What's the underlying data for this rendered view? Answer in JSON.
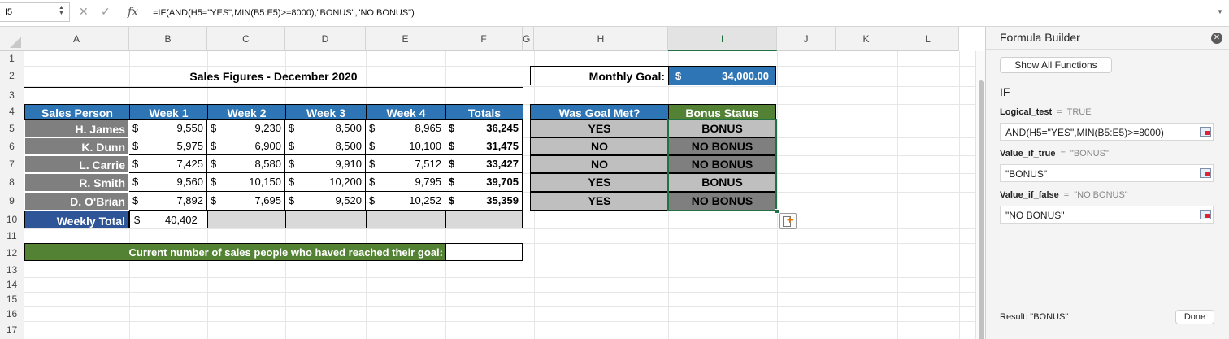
{
  "formula_bar": {
    "name_box": "I5",
    "cancel_glyph": "✕",
    "enter_glyph": "✓",
    "fx_label": "fx",
    "formula": "=IF(AND(H5=\"YES\",MIN(B5:E5)>=8000),\"BONUS\",\"NO BONUS\")"
  },
  "columns": [
    "A",
    "B",
    "C",
    "D",
    "E",
    "F",
    "G",
    "H",
    "I",
    "J",
    "K",
    "L"
  ],
  "selected_column": "I",
  "rows": [
    "1",
    "2",
    "3",
    "4",
    "5",
    "6",
    "7",
    "8",
    "9",
    "10",
    "11",
    "12",
    "13",
    "14",
    "15",
    "16",
    "17"
  ],
  "sheet": {
    "title": "Sales Figures - December 2020",
    "monthly_goal_label": "Monthly Goal:",
    "monthly_goal_currency": "$",
    "monthly_goal_value": "34,000.00",
    "headers": [
      "Sales Person",
      "Week 1",
      "Week 2",
      "Week 3",
      "Week 4",
      "Totals"
    ],
    "goal_header": "Was Goal Met?",
    "bonus_header": "Bonus Status",
    "currency": "$",
    "data": [
      {
        "name": "H. James",
        "w1": "9,550",
        "w2": "9,230",
        "w3": "8,500",
        "w4": "8,965",
        "total": "36,245",
        "goal": "YES",
        "bonus": "BONUS"
      },
      {
        "name": "K. Dunn",
        "w1": "5,975",
        "w2": "6,900",
        "w3": "8,500",
        "w4": "10,100",
        "total": "31,475",
        "goal": "NO",
        "bonus": "NO BONUS"
      },
      {
        "name": "L. Carrie",
        "w1": "7,425",
        "w2": "8,580",
        "w3": "9,910",
        "w4": "7,512",
        "total": "33,427",
        "goal": "NO",
        "bonus": "NO BONUS"
      },
      {
        "name": "R. Smith",
        "w1": "9,560",
        "w2": "10,150",
        "w3": "10,200",
        "w4": "9,795",
        "total": "39,705",
        "goal": "YES",
        "bonus": "BONUS"
      },
      {
        "name": "D. O'Brian",
        "w1": "7,892",
        "w2": "7,695",
        "w3": "9,520",
        "w4": "10,252",
        "total": "35,359",
        "goal": "YES",
        "bonus": "NO BONUS"
      }
    ],
    "weekly_total_label": "Weekly Total",
    "weekly_total_value": "40,402",
    "reached_goal_label": "Current number of sales people who haved reached their goal:"
  },
  "formula_builder": {
    "title": "Formula Builder",
    "close_glyph": "✕",
    "show_all_label": "Show All Functions",
    "function_name": "IF",
    "args": [
      {
        "label": "Logical_test",
        "eq": "=",
        "value": "TRUE",
        "input": "AND(H5=\"YES\",MIN(B5:E5)>=8000)"
      },
      {
        "label": "Value_if_true",
        "eq": "=",
        "value": "\"BONUS\"",
        "input": "\"BONUS\""
      },
      {
        "label": "Value_if_false",
        "eq": "=",
        "value": "\"NO BONUS\"",
        "input": "\"NO BONUS\""
      }
    ],
    "result": "Result: \"BONUS\"",
    "done_label": "Done"
  }
}
